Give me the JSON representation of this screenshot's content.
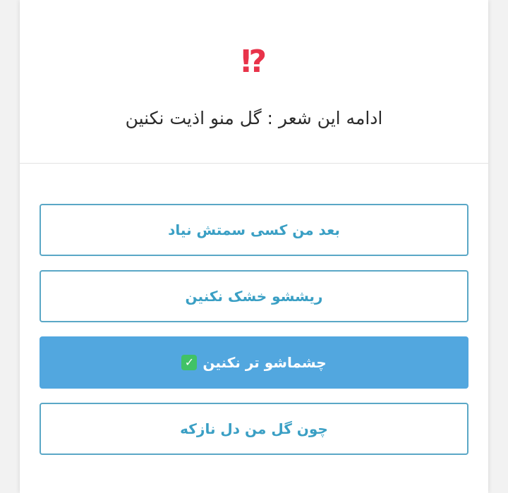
{
  "header": {
    "icon": "⁉️",
    "icon_name": "exclamation-question-mark-icon",
    "question": "ادامه این شعر : گل منو اذیت نکنین"
  },
  "options": [
    {
      "label": "بعد من کسی سمتش نیاد",
      "selected": false
    },
    {
      "label": "ریششو خشک نکنین",
      "selected": false
    },
    {
      "label": "چشماشو تر نکنین",
      "selected": true,
      "mark": "✅"
    },
    {
      "label": "چون گل من دل نازکه",
      "selected": false
    }
  ],
  "colors": {
    "option_border": "#5aa7c6",
    "option_text": "#3a9fc4",
    "selected_bg": "#52a7df",
    "check_green": "#41c266"
  }
}
